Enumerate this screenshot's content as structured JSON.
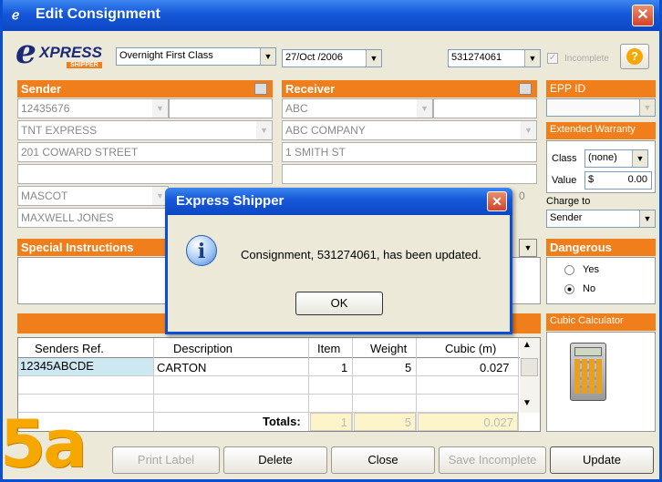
{
  "window": {
    "title": "Edit Consignment",
    "close_label": "✕"
  },
  "top": {
    "logo_main": "XPRESS",
    "logo_sub": "SHIPPER",
    "service": "Overnight First Class",
    "date": "27/Oct /2006",
    "consignment_no": "531274061",
    "incomplete_label": "Incomplete",
    "help_label": "?"
  },
  "sender": {
    "header": "Sender",
    "account": "12435676",
    "company": "TNT EXPRESS",
    "address1": "201 COWARD STREET",
    "address2": "",
    "suburb": "MASCOT",
    "contact": "MAXWELL JONES"
  },
  "receiver": {
    "header": "Receiver",
    "account": "ABC",
    "company": "ABC COMPANY",
    "address1": "1 SMITH ST",
    "address2": "",
    "postcode_tail": "0"
  },
  "right_panel": {
    "epp_header": "EPP ID",
    "warranty_header": "Extended Warranty",
    "class_label": "Class",
    "class_value": "(none)",
    "value_label": "Value",
    "currency": "$",
    "value_amount": "0.00",
    "charge_to_label": "Charge to",
    "charge_to_value": "Sender",
    "dangerous_header": "Dangerous",
    "yes_label": "Yes",
    "no_label": "No",
    "cubic_header": "Cubic Calculator"
  },
  "special": {
    "header": "Special Instructions"
  },
  "grid": {
    "columns": [
      "Senders Ref.",
      "Description",
      "Item",
      "Weight",
      "Cubic (m)"
    ],
    "rows": [
      {
        "ref": "12345ABCDE",
        "desc": "CARTON",
        "item": "1",
        "weight": "5",
        "cubic": "0.027"
      }
    ],
    "totals_label": "Totals:",
    "totals_item": "1",
    "totals_weight": "5",
    "totals_cubic": "0.027"
  },
  "buttons": {
    "print": "Print Label",
    "delete": "Delete",
    "close": "Close",
    "save_incomplete": "Save Incomplete",
    "update": "Update"
  },
  "dialog": {
    "title": "Express Shipper",
    "message": "Consignment, 531274061, has been updated.",
    "ok": "OK",
    "close": "✕"
  },
  "step_label": "5a",
  "colors": {
    "accent": "#f07e1a",
    "titlebar": "#1457d8",
    "step": "#f6a800"
  }
}
